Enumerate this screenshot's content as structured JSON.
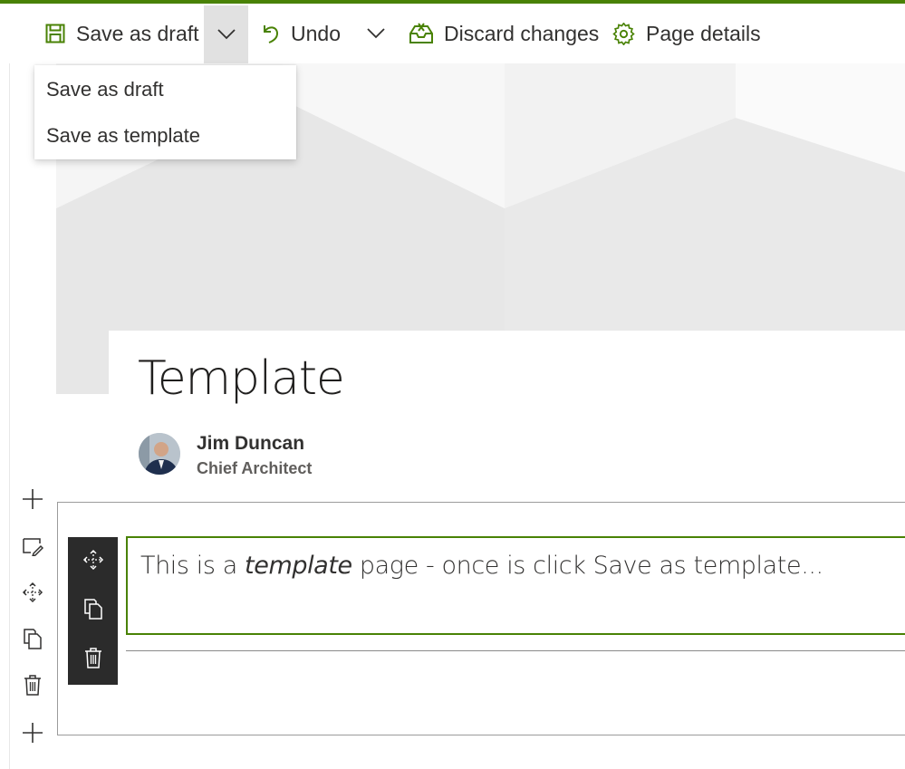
{
  "toolbar": {
    "save_label": "Save as draft",
    "undo_label": "Undo",
    "discard_label": "Discard changes",
    "page_details_label": "Page details"
  },
  "save_menu": {
    "items": [
      "Save as draft",
      "Save as template"
    ]
  },
  "page": {
    "title": "Template",
    "author_name": "Jim Duncan",
    "author_role": "Chief Architect"
  },
  "text_webpart": {
    "before": "This is a ",
    "emphasis": "template",
    "after": " page - once is click Save as template..."
  },
  "icons": {
    "save": "save-icon",
    "chevron": "chevron-down-icon",
    "undo": "undo-icon",
    "discard": "discard-icon",
    "settings": "gear-icon",
    "add": "plus-icon",
    "edit": "edit-icon",
    "move": "move-icon",
    "duplicate": "duplicate-icon",
    "delete": "trash-icon"
  },
  "colors": {
    "accent": "#498205",
    "toolbox_bg": "#2b2b2b",
    "chevron_active": "#e1e1e1"
  }
}
